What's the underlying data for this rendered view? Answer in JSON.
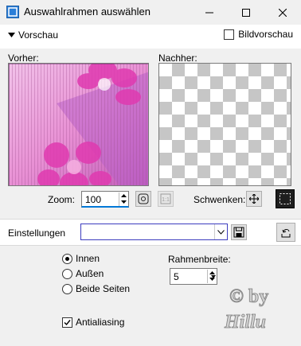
{
  "window": {
    "title": "Auswahlrahmen auswählen"
  },
  "preview": {
    "toggle_label": "Vorschau",
    "bildvorschau_label": "Bildvorschau",
    "bildvorschau_checked": false,
    "before_label": "Vorher:",
    "after_label": "Nachher:"
  },
  "zoom": {
    "label": "Zoom:",
    "value": "100",
    "pan_label": "Schwenken:"
  },
  "settings": {
    "label": "Einstellungen",
    "value": ""
  },
  "options": {
    "radio_innen": "Innen",
    "radio_aussen": "Außen",
    "radio_beide": "Beide Seiten",
    "selected": "Innen",
    "rahmenbreite_label": "Rahmenbreite:",
    "rahmenbreite_value": "5",
    "antialiasing_label": "Antialiasing",
    "antialiasing_checked": true
  },
  "watermark": {
    "line1": "© by",
    "line2": "Hillu"
  },
  "colors": {
    "accent": "#0078d7",
    "combo_border": "#3c3cbe",
    "preview_pink": "#e040b8"
  }
}
